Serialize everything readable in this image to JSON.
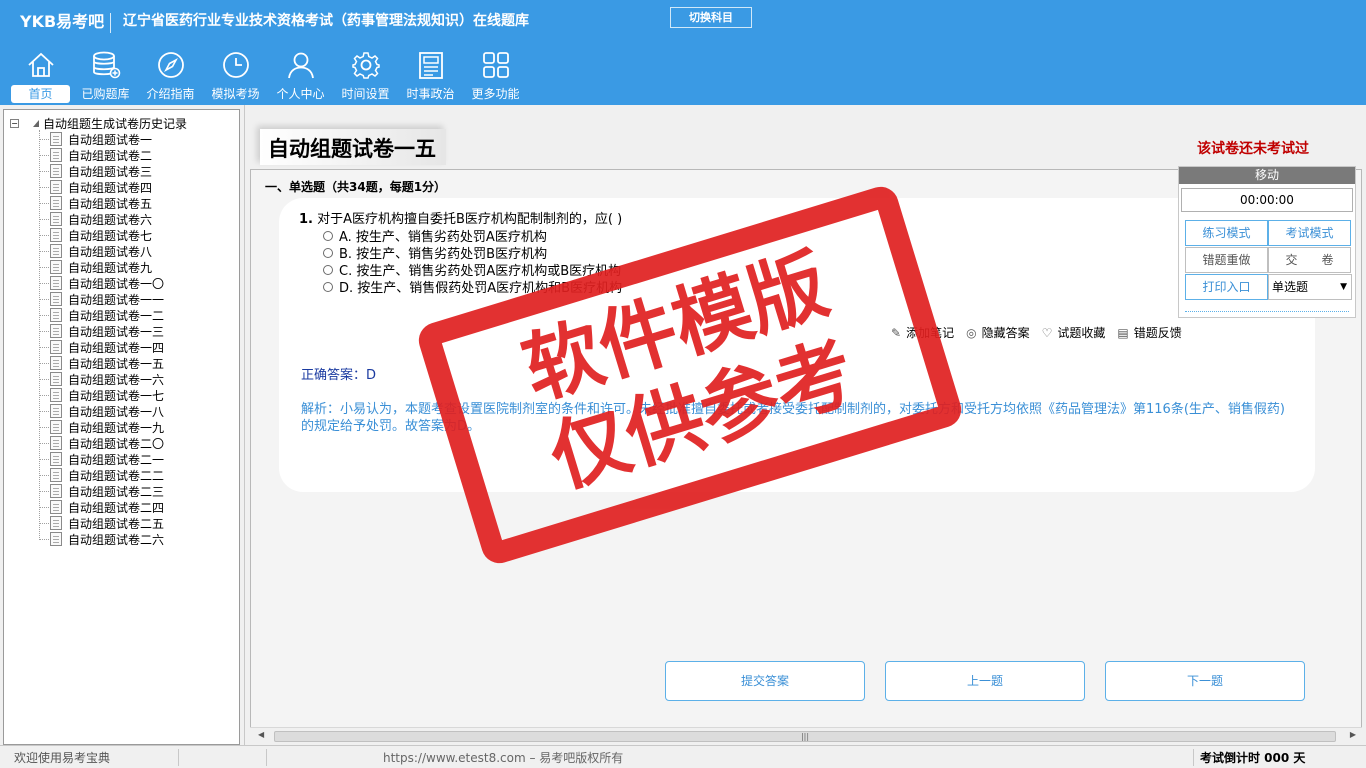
{
  "header": {
    "brand": "YKB易考吧",
    "title": "辽宁省医药行业专业技术资格考试（药事管理法规知识）在线题库",
    "switch_label": "切换科目",
    "nav": [
      {
        "label": "首页",
        "icon": "home-icon"
      },
      {
        "label": "已购题库",
        "icon": "database-icon"
      },
      {
        "label": "介绍指南",
        "icon": "compass-icon"
      },
      {
        "label": "模拟考场",
        "icon": "clock-icon"
      },
      {
        "label": "个人中心",
        "icon": "user-icon"
      },
      {
        "label": "时间设置",
        "icon": "gear-icon"
      },
      {
        "label": "时事政治",
        "icon": "news-icon"
      },
      {
        "label": "更多功能",
        "icon": "grid-icon"
      }
    ]
  },
  "sidebar": {
    "root_label": "自动组题生成试卷历史记录",
    "items": [
      "自动组题试卷一",
      "自动组题试卷二",
      "自动组题试卷三",
      "自动组题试卷四",
      "自动组题试卷五",
      "自动组题试卷六",
      "自动组题试卷七",
      "自动组题试卷八",
      "自动组题试卷九",
      "自动组题试卷一〇",
      "自动组题试卷一一",
      "自动组题试卷一二",
      "自动组题试卷一三",
      "自动组题试卷一四",
      "自动组题试卷一五",
      "自动组题试卷一六",
      "自动组题试卷一七",
      "自动组题试卷一八",
      "自动组题试卷一九",
      "自动组题试卷二〇",
      "自动组题试卷二一",
      "自动组题试卷二二",
      "自动组题试卷二三",
      "自动组题试卷二四",
      "自动组题试卷二五",
      "自动组题试卷二六"
    ]
  },
  "main": {
    "paper_title": "自动组题试卷一五",
    "exam_status": "该试卷还未考试过",
    "section_title": "一、单选题（共34题，每题1分）",
    "question": {
      "number": "1.",
      "text": "对于A医疗机构擅自委托B医疗机构配制制剂的，应( )",
      "options": [
        "A. 按生产、销售劣药处罚A医疗机构",
        "B. 按生产、销售劣药处罚B医疗机构",
        "C. 按生产、销售劣药处罚A医疗机构或B医疗机构",
        "D. 按生产、销售假药处罚A医疗机构和B医疗机构"
      ]
    },
    "actions": [
      {
        "label": "添加笔记",
        "icon": "pencil-icon"
      },
      {
        "label": "隐藏答案",
        "icon": "eye-icon"
      },
      {
        "label": "试题收藏",
        "icon": "heart-icon"
      },
      {
        "label": "错题反馈",
        "icon": "feedback-icon"
      }
    ],
    "answer": "正确答案：D",
    "analysis": "解析：小易认为，本题考查设置医院制剂室的条件和许可。未经批准擅自委托或者接受委托配制制剂的，对委托方和受托方均依照《药品管理法》第116条(生产、销售假药)的规定给予处罚。故答案为D。",
    "buttons": {
      "submit": "提交答案",
      "prev": "上一题",
      "next": "下一题"
    }
  },
  "float_panel": {
    "move_label": "移动",
    "timer": "00:00:00",
    "practice_mode": "练习模式",
    "exam_mode": "考试模式",
    "redo_wrong": "错题重做",
    "hand_in": "交　　卷",
    "print_entry": "打印入口",
    "question_type": "单选题"
  },
  "watermark": {
    "line1": "软件模版",
    "line2": "仅供参考"
  },
  "statusbar": {
    "welcome": "欢迎使用易考宝典",
    "copyright": "https://www.etest8.com – 易考吧版权所有",
    "countdown": "考试倒计时 000 天"
  },
  "colors": {
    "header_bg": "#3a9ae4",
    "accent": "#3a8fd6",
    "status_red": "#c00000",
    "stamp_red": "#e02020"
  }
}
